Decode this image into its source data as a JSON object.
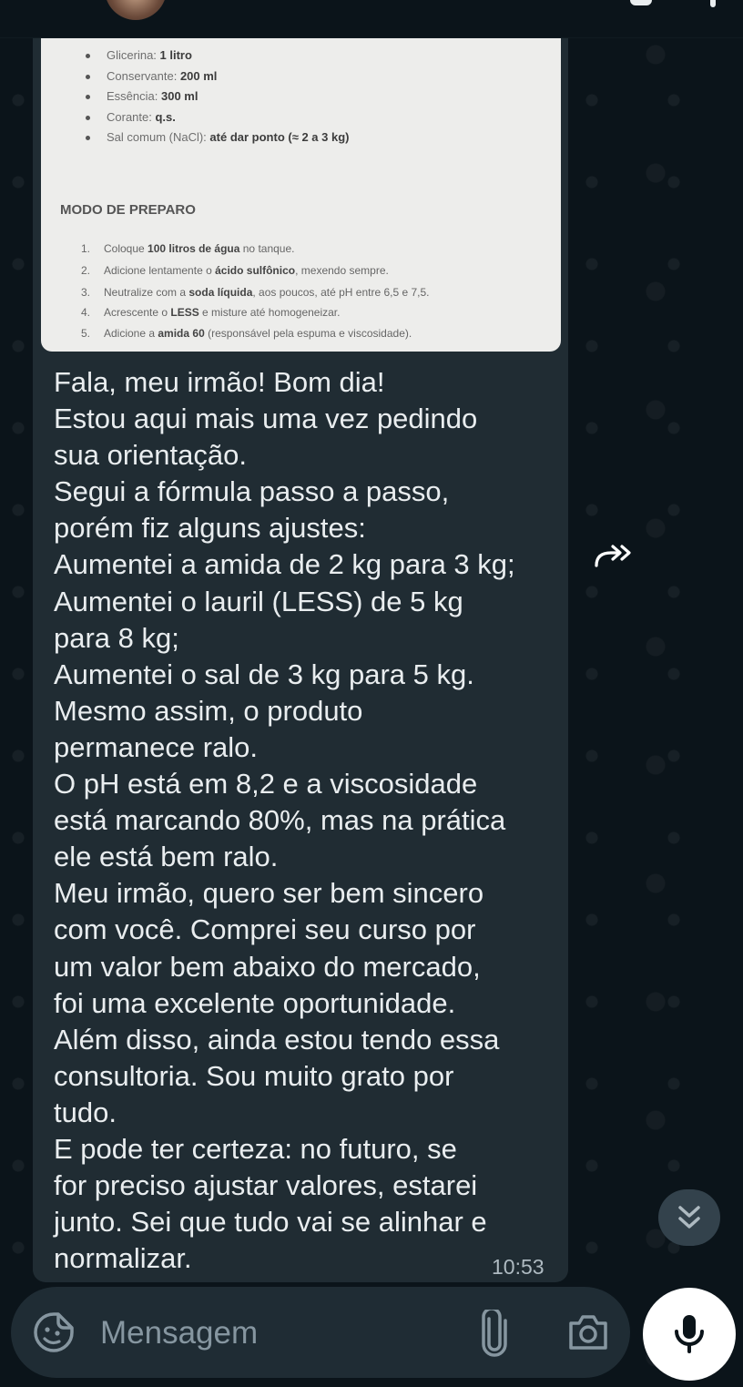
{
  "chat": {
    "image_doc": {
      "ingredients": [
        {
          "label": "Glicerina: ",
          "value": "1 litro"
        },
        {
          "label": "Conservante: ",
          "value": "200 ml"
        },
        {
          "label": "Essência: ",
          "value": "300 ml"
        },
        {
          "label": "Corante: ",
          "value": "q.s."
        },
        {
          "label": "Sal comum (NaCl): ",
          "value": "até dar ponto (≈ 2 a 3 kg)"
        }
      ],
      "section_title": "MODO DE PREPARO",
      "steps": [
        {
          "num": "1.",
          "pre": "Coloque ",
          "bold": "100 litros de água",
          "post": " no tanque."
        },
        {
          "num": "2.",
          "pre": "Adicione lentamente o ",
          "bold": "ácido sulfônico",
          "post": ", mexendo sempre."
        },
        {
          "num": "3.",
          "pre": "Neutralize com a ",
          "bold": "soda líquida",
          "post": ", aos poucos, até pH entre 6,5 e 7,5."
        },
        {
          "num": "4.",
          "pre": "Acrescente o ",
          "bold": "LESS",
          "post": " e misture até homogeneizar."
        },
        {
          "num": "5.",
          "pre": "Adicione a ",
          "bold": "amida 60",
          "post": " (responsável pela espuma e viscosidade)."
        }
      ]
    },
    "message_text": "Fala, meu irmão! Bom dia!\nEstou aqui mais uma vez pedindo\nsua orientação.\nSegui a fórmula passo a passo,\nporém fiz alguns ajustes:\nAumentei a amida de 2 kg para 3 kg;\nAumentei o lauril (LESS) de 5 kg\npara 8 kg;\nAumentei o sal de 3 kg para 5 kg.\nMesmo assim, o produto\npermanece ralo.\nO pH está em 8,2 e a viscosidade\nestá marcando 80%, mas na prática\nele está bem ralo.\nMeu irmão, quero ser bem sincero\ncom você. Comprei seu curso por\num valor bem abaixo do mercado,\nfoi uma excelente oportunidade.\nAlém disso, ainda estou tendo essa\nconsultoria. Sou muito grato por\ntudo.\nE pode ter certeza: no futuro, se\nfor preciso ajustar valores, estarei\njunto. Sei que tudo vai se alinhar e\nnormalizar.",
    "message_time": "10:53"
  },
  "input": {
    "placeholder": "Mensagem"
  },
  "icons": {
    "forward": "forward-icon",
    "scroll_down": "double-chevron-down-icon",
    "emoji": "sticker-emoji-icon",
    "attach": "paperclip-icon",
    "camera": "camera-icon",
    "mic": "microphone-icon"
  },
  "colors": {
    "background": "#0b141a",
    "bubble": "#202c33",
    "input_bar": "#1f2c34",
    "mic_button": "#ffffff"
  }
}
